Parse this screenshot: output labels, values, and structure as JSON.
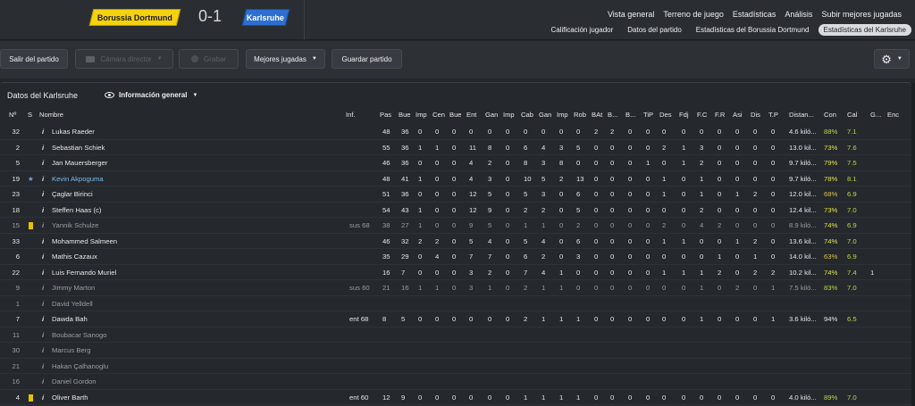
{
  "match": {
    "home": "Borussia Dortmund",
    "away": "Karlsruhe",
    "score": "0-1"
  },
  "nav": {
    "top": [
      "Vista general",
      "Terreno de juego",
      "Estadísticas",
      "Análisis",
      "Subir mejores jugadas"
    ],
    "top_active": 2,
    "sub": [
      "Calificación jugador",
      "Datos del partido",
      "Estadísticas del Borussia Dortmund",
      "Estadísticas del Karlsruhe"
    ],
    "sub_active": 3
  },
  "toolbar": {
    "exit": "Salir del partido",
    "camera": "Cámara director",
    "record": "Grabar",
    "best": "Mejores jugadas",
    "save": "Guardar partido",
    "settings_icon": "gear-icon"
  },
  "panel": {
    "title": "Datos del Karlsruhe",
    "view": "Información general",
    "view_icon": "eye-icon"
  },
  "columns": [
    "Nº",
    "S",
    "Nombre",
    "Inf.",
    "Pas",
    "Bue",
    "Imp",
    "Cen",
    "Bue",
    "Ent",
    "Gan",
    "Imp",
    "Cab",
    "Gan",
    "Imp",
    "Rob",
    "BAt",
    "B...",
    "B...",
    "TiP",
    "Des",
    "Fdj",
    "F.C",
    "F.R",
    "Asi",
    "Dis",
    "T.P",
    "Distan...",
    "Con",
    "Cal",
    "G...",
    "Enc"
  ],
  "players": [
    {
      "n": "32",
      "s": "",
      "name": "Lukas Raeder",
      "inf": "",
      "v": [
        "48",
        "36",
        "0",
        "0",
        "0",
        "0",
        "0",
        "0",
        "0",
        "0",
        "0",
        "0",
        "2",
        "2",
        "0",
        "0",
        "0",
        "0",
        "0",
        "0",
        "0",
        "0",
        "0",
        "4.6 kiló...",
        "88%",
        "7.1",
        "",
        ""
      ],
      "con_c": "good",
      "cal_c": "good"
    },
    {
      "n": "2",
      "s": "",
      "name": "Sebastian Schiek",
      "inf": "",
      "v": [
        "55",
        "36",
        "1",
        "1",
        "0",
        "11",
        "8",
        "0",
        "6",
        "4",
        "3",
        "5",
        "0",
        "0",
        "0",
        "0",
        "2",
        "1",
        "3",
        "0",
        "0",
        "0",
        "0",
        "13.0 kil...",
        "73%",
        "7.6",
        "",
        ""
      ],
      "con_c": "warn",
      "cal_c": "good"
    },
    {
      "n": "5",
      "s": "",
      "name": "Jan Mauersberger",
      "inf": "",
      "v": [
        "46",
        "36",
        "0",
        "0",
        "0",
        "4",
        "2",
        "0",
        "8",
        "3",
        "8",
        "0",
        "0",
        "0",
        "0",
        "1",
        "0",
        "1",
        "2",
        "0",
        "0",
        "0",
        "0",
        "9.7 kiló...",
        "79%",
        "7.5",
        "",
        ""
      ],
      "con_c": "warn",
      "cal_c": "good"
    },
    {
      "n": "19",
      "s": "star",
      "name": "Kevin Akpoguma",
      "inf": "",
      "v": [
        "48",
        "41",
        "1",
        "0",
        "0",
        "4",
        "3",
        "0",
        "10",
        "5",
        "2",
        "13",
        "0",
        "0",
        "0",
        "0",
        "1",
        "0",
        "1",
        "0",
        "0",
        "0",
        "0",
        "9.7 kiló...",
        "78%",
        "8.1",
        "",
        ""
      ],
      "con_c": "warn",
      "cal_c": "good",
      "blue": true
    },
    {
      "n": "23",
      "s": "",
      "name": "Çaglar Birinci",
      "inf": "",
      "v": [
        "51",
        "36",
        "0",
        "0",
        "0",
        "12",
        "5",
        "0",
        "5",
        "3",
        "0",
        "6",
        "0",
        "0",
        "0",
        "0",
        "1",
        "0",
        "1",
        "0",
        "1",
        "2",
        "0",
        "12.0 kil...",
        "68%",
        "6.9",
        "",
        ""
      ],
      "con_c": "mid",
      "cal_c": "good"
    },
    {
      "n": "18",
      "s": "",
      "name": "Steffen Haas (c)",
      "inf": "",
      "v": [
        "54",
        "43",
        "1",
        "0",
        "0",
        "12",
        "9",
        "0",
        "2",
        "2",
        "0",
        "5",
        "0",
        "0",
        "0",
        "0",
        "0",
        "0",
        "2",
        "0",
        "0",
        "0",
        "0",
        "12.4 kil...",
        "73%",
        "7.0",
        "",
        ""
      ],
      "con_c": "warn",
      "cal_c": "good"
    },
    {
      "n": "15",
      "s": "yellow",
      "name": "Yannik Schulze",
      "inf": "sus 68",
      "v": [
        "38",
        "27",
        "1",
        "0",
        "0",
        "9",
        "5",
        "0",
        "1",
        "1",
        "0",
        "2",
        "0",
        "0",
        "0",
        "0",
        "2",
        "0",
        "4",
        "2",
        "0",
        "0",
        "0",
        "8.9 kiló...",
        "74%",
        "6.9",
        "",
        ""
      ],
      "con_c": "warn",
      "cal_c": "good",
      "dim": true
    },
    {
      "n": "33",
      "s": "",
      "name": "Mohammed Salmeen",
      "inf": "",
      "v": [
        "46",
        "32",
        "2",
        "2",
        "0",
        "5",
        "4",
        "0",
        "5",
        "4",
        "0",
        "6",
        "0",
        "0",
        "0",
        "0",
        "1",
        "1",
        "0",
        "0",
        "1",
        "2",
        "0",
        "13.6 kil...",
        "74%",
        "7.0",
        "",
        ""
      ],
      "con_c": "warn",
      "cal_c": "good"
    },
    {
      "n": "6",
      "s": "",
      "name": "Mathis Cazaux",
      "inf": "",
      "v": [
        "35",
        "29",
        "0",
        "4",
        "0",
        "7",
        "7",
        "0",
        "6",
        "2",
        "0",
        "3",
        "0",
        "0",
        "0",
        "0",
        "0",
        "0",
        "0",
        "1",
        "0",
        "1",
        "0",
        "14.0 kil...",
        "63%",
        "6.9",
        "",
        ""
      ],
      "con_c": "mid",
      "cal_c": "good"
    },
    {
      "n": "22",
      "s": "",
      "name": "Luis Fernando Muriel",
      "inf": "",
      "v": [
        "16",
        "7",
        "0",
        "0",
        "0",
        "3",
        "2",
        "0",
        "7",
        "4",
        "1",
        "0",
        "0",
        "0",
        "0",
        "0",
        "1",
        "1",
        "1",
        "2",
        "0",
        "2",
        "2",
        "10.2 kil...",
        "74%",
        "7.4",
        "1",
        ""
      ],
      "con_c": "warn",
      "cal_c": "good"
    },
    {
      "n": "9",
      "s": "",
      "name": "Jimmy Marton",
      "inf": "sus 60",
      "v": [
        "21",
        "16",
        "1",
        "1",
        "0",
        "3",
        "1",
        "0",
        "2",
        "1",
        "1",
        "0",
        "0",
        "0",
        "0",
        "0",
        "0",
        "0",
        "1",
        "0",
        "2",
        "0",
        "1",
        "7.5 kiló...",
        "83%",
        "7.0",
        "",
        ""
      ],
      "con_c": "good",
      "cal_c": "good",
      "dim": true
    },
    {
      "n": "1",
      "s": "",
      "name": "David Yelldell",
      "inf": "",
      "v": [],
      "dim": true
    },
    {
      "n": "7",
      "s": "",
      "name": "Dawda Bah",
      "inf": "ent 68",
      "v": [
        "8",
        "5",
        "0",
        "0",
        "0",
        "0",
        "0",
        "0",
        "2",
        "1",
        "1",
        "1",
        "0",
        "0",
        "0",
        "0",
        "0",
        "0",
        "1",
        "0",
        "0",
        "0",
        "1",
        "3.6 kiló...",
        "94%",
        "6.5",
        "",
        ""
      ],
      "con_c": "",
      "cal_c": "good"
    },
    {
      "n": "11",
      "s": "",
      "name": "Boubacar Sanogo",
      "inf": "",
      "v": [],
      "dim": true
    },
    {
      "n": "30",
      "s": "",
      "name": "Marcus Berg",
      "inf": "",
      "v": [],
      "dim": true
    },
    {
      "n": "21",
      "s": "",
      "name": "Hakan Çalhanoglu",
      "inf": "",
      "v": [],
      "dim": true
    },
    {
      "n": "16",
      "s": "",
      "name": "Daniel Gordon",
      "inf": "",
      "v": [],
      "dim": true
    },
    {
      "n": "4",
      "s": "yellow",
      "name": "Oliver Barth",
      "inf": "ent 60",
      "v": [
        "12",
        "9",
        "0",
        "0",
        "0",
        "0",
        "0",
        "0",
        "1",
        "1",
        "1",
        "1",
        "0",
        "0",
        "0",
        "0",
        "0",
        "0",
        "0",
        "0",
        "0",
        "0",
        "0",
        "4.0 kiló...",
        "89%",
        "7.0",
        "",
        ""
      ],
      "con_c": "good",
      "cal_c": "good"
    }
  ]
}
